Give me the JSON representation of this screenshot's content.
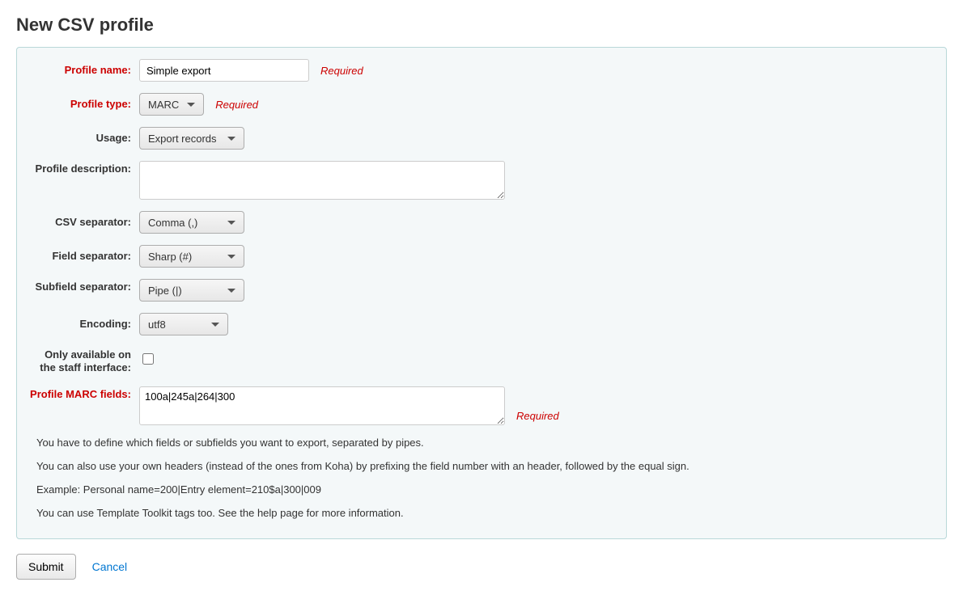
{
  "title": "New CSV profile",
  "labels": {
    "profile_name": "Profile name:",
    "profile_type": "Profile type:",
    "usage": "Usage:",
    "profile_description": "Profile description:",
    "csv_separator": "CSV separator:",
    "field_separator": "Field separator:",
    "subfield_separator": "Subfield separator:",
    "encoding": "Encoding:",
    "staff_only": "Only available on the staff interface:",
    "profile_marc_fields": "Profile MARC fields:"
  },
  "values": {
    "profile_name": "Simple export",
    "profile_type": "MARC",
    "usage": "Export records",
    "profile_description": "",
    "csv_separator": "Comma (,)",
    "field_separator": "Sharp (#)",
    "subfield_separator": "Pipe (|)",
    "encoding": "utf8",
    "staff_only": false,
    "profile_marc_fields": "100a|245a|264|300"
  },
  "required_text": "Required",
  "help": {
    "l1": "You have to define which fields or subfields you want to export, separated by pipes.",
    "l2": "You can also use your own headers (instead of the ones from Koha) by prefixing the field number with an header, followed by the equal sign.",
    "l3": "Example: Personal name=200|Entry element=210$a|300|009",
    "l4": "You can use Template Toolkit tags too. See the help page for more information."
  },
  "actions": {
    "submit": "Submit",
    "cancel": "Cancel"
  }
}
